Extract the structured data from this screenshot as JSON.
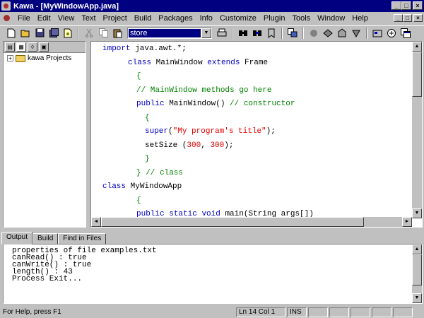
{
  "window": {
    "title": "Kawa - [MyWindowApp.java]",
    "title_buttons": [
      "_",
      "□",
      "×"
    ]
  },
  "menu": {
    "items": [
      "File",
      "Edit",
      "View",
      "Text",
      "Project",
      "Build",
      "Packages",
      "Info",
      "Customize",
      "Plugin",
      "Tools",
      "Window",
      "Help"
    ],
    "mdi_buttons": [
      "_",
      "□",
      "×"
    ]
  },
  "toolbar": {
    "combo_value": "store"
  },
  "left_panel": {
    "tree_root": "kawa Projects"
  },
  "editor": {
    "lines": [
      {
        "indent": 0,
        "parts": [
          {
            "t": "import",
            "c": "kw"
          },
          {
            "t": " java.awt.*;",
            "c": ""
          }
        ]
      },
      {
        "indent": 3,
        "parts": [
          {
            "t": "class",
            "c": "kw"
          },
          {
            "t": " MainWindow ",
            "c": ""
          },
          {
            "t": "extends",
            "c": "kw"
          },
          {
            "t": " Frame",
            "c": ""
          }
        ]
      },
      {
        "indent": 4,
        "parts": [
          {
            "t": "{",
            "c": "cm"
          }
        ]
      },
      {
        "indent": 4,
        "parts": [
          {
            "t": "// MainWindow methods go here",
            "c": "cm"
          }
        ]
      },
      {
        "indent": 4,
        "parts": [
          {
            "t": "public",
            "c": "kw"
          },
          {
            "t": " MainWindow() ",
            "c": ""
          },
          {
            "t": "// constructor",
            "c": "cm"
          }
        ]
      },
      {
        "indent": 5,
        "parts": [
          {
            "t": "{",
            "c": "cm"
          }
        ]
      },
      {
        "indent": 5,
        "parts": [
          {
            "t": "super",
            "c": "kw"
          },
          {
            "t": "(",
            "c": ""
          },
          {
            "t": "\"My program's title\"",
            "c": "st"
          },
          {
            "t": ");",
            "c": ""
          }
        ]
      },
      {
        "indent": 5,
        "parts": [
          {
            "t": "setSize (",
            "c": ""
          },
          {
            "t": "300",
            "c": "st"
          },
          {
            "t": ", ",
            "c": ""
          },
          {
            "t": "300",
            "c": "st"
          },
          {
            "t": ");",
            "c": ""
          }
        ]
      },
      {
        "indent": 5,
        "parts": [
          {
            "t": "}",
            "c": "cm"
          }
        ]
      },
      {
        "indent": 4,
        "parts": [
          {
            "t": "} // class",
            "c": "cm"
          }
        ]
      },
      {
        "indent": 0,
        "parts": [
          {
            "t": "class",
            "c": "kw"
          },
          {
            "t": " MyWindowApp",
            "c": ""
          }
        ]
      },
      {
        "indent": 4,
        "parts": [
          {
            "t": "{",
            "c": "cm"
          }
        ]
      },
      {
        "indent": 4,
        "parts": [
          {
            "t": "public",
            "c": "kw"
          },
          {
            "t": " ",
            "c": ""
          },
          {
            "t": "static",
            "c": "kw"
          },
          {
            "t": " ",
            "c": ""
          },
          {
            "t": "void",
            "c": "kw"
          },
          {
            "t": " main(String args[])",
            "c": ""
          }
        ]
      }
    ]
  },
  "output_tabs": [
    "Output",
    "Build",
    "Find in Files"
  ],
  "output": {
    "lines": [
      "properties of file examples.txt",
      "canRead() : true",
      "canWrite() : true",
      "length() : 43",
      "Process Exit..."
    ]
  },
  "status": {
    "help": "For Help, press F1",
    "position": "Ln 14 Col 1",
    "mode": "INS"
  }
}
